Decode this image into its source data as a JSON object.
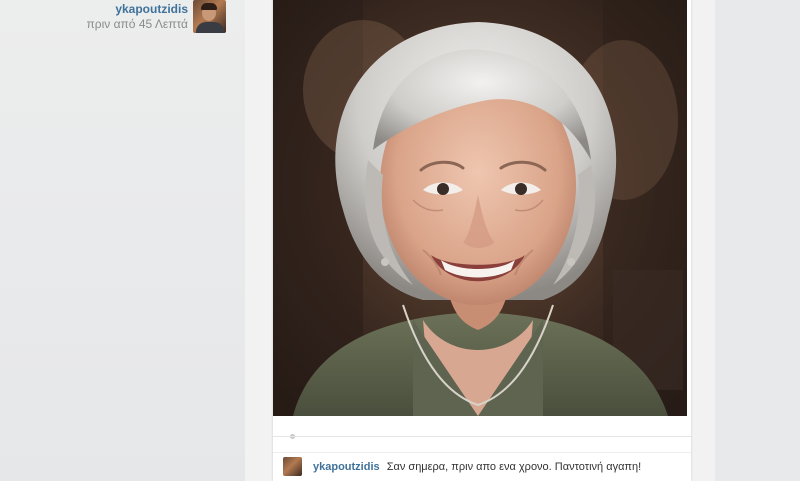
{
  "post": {
    "author": "ykapoutzidis",
    "time": "πριν από 45 Λεπτά",
    "caption_user": "ykapoutzidis",
    "caption_text": "Σαν σημερα, πριν απο ενα χρονο. Παντοτινή αγαπη!"
  },
  "colors": {
    "link": "#3f729b",
    "muted": "#8a8a8a",
    "page_bg": "#e7e8ea",
    "card_bg": "#ffffff"
  },
  "icons": {
    "author_avatar": "author-avatar",
    "caption_avatar": "commenter-avatar"
  }
}
